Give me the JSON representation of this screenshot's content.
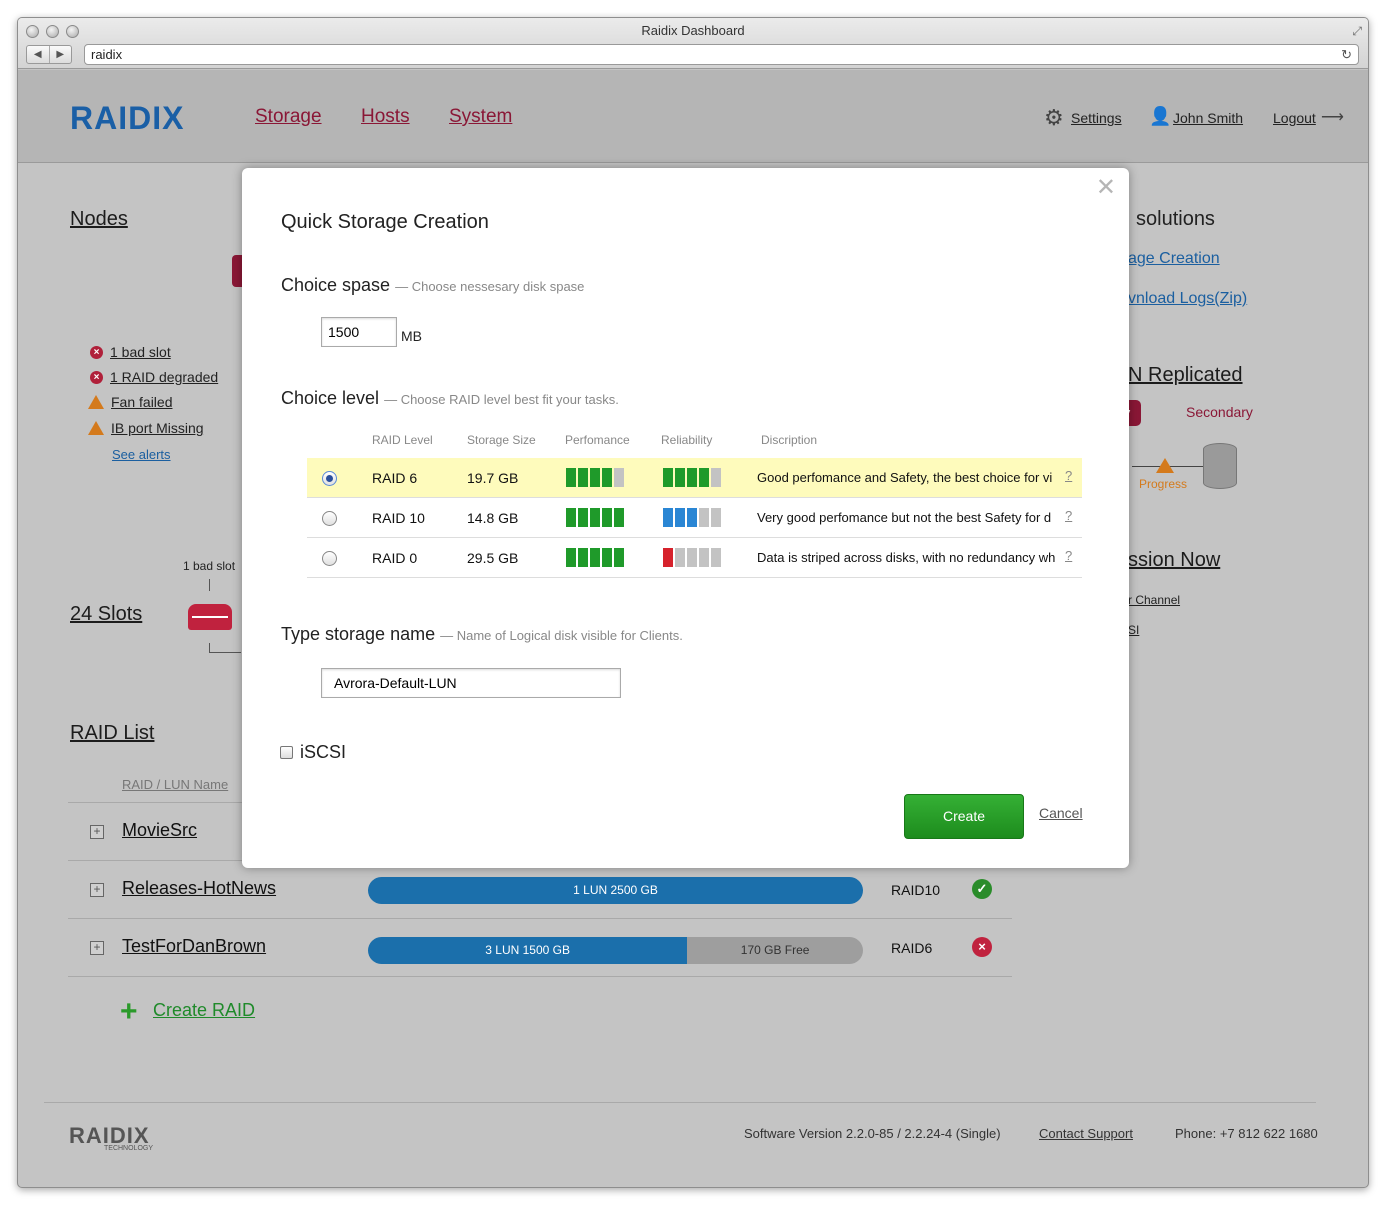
{
  "window": {
    "title": "Raidix Dashboard",
    "url": "raidix"
  },
  "header": {
    "logo": "RAIDIX",
    "nav": [
      "Storage",
      "Hosts",
      "System"
    ],
    "settings": "Settings",
    "user": "John Smith",
    "logout": "Logout"
  },
  "nodes": {
    "title": "Nodes",
    "alerts": [
      "1 bad slot",
      "1 RAID degraded",
      "Fan failed",
      "IB port Missing"
    ],
    "see_alerts": "See alerts"
  },
  "slots": {
    "title": "24 Slots",
    "bad_slot": "1 bad slot"
  },
  "raid_list": {
    "title": "RAID List",
    "column": "RAID / LUN Name",
    "rows": [
      {
        "name": "MovieSrc"
      },
      {
        "name": "Releases-HotNews",
        "bar": "1 LUN  2500 GB",
        "used_fraction": 1.0,
        "free": "",
        "level": "RAID10",
        "status": "ok"
      },
      {
        "name": "TestForDanBrown",
        "bar": "3 LUN  1500 GB",
        "used_fraction": 0.645,
        "free": "170 GB Free",
        "level": "RAID6",
        "status": "error"
      }
    ],
    "create": "Create RAID"
  },
  "right": {
    "solutions": "solutions",
    "link1": "age Creation",
    "link2": "vnload Logs(Zip)",
    "replicated": "N Replicated",
    "tag": "y",
    "secondary": "Secondary",
    "progress": "Progress",
    "session": "ssion Now",
    "channel": "r Channel",
    "si": "SI"
  },
  "footer": {
    "logo": "RAIDIX",
    "logo_sub": "TECHNOLOGY",
    "version": "Software Version 2.2.0-85 / 2.2.24-4 (Single)",
    "contact": "Contact Support",
    "phone": "Phone: +7 812 622 1680"
  },
  "modal": {
    "title": "Quick Storage Creation",
    "space": {
      "label": "Choice spase",
      "hint": "— Choose nessesary disk spase",
      "value": "1500",
      "unit": "MB"
    },
    "level": {
      "label": "Choice level",
      "hint": "— Choose RAID level best fit your tasks.",
      "headers": [
        "RAID Level",
        "Storage Size",
        "Perfomance",
        "Reliability",
        "Discription"
      ],
      "rows": [
        {
          "level": "RAID 6",
          "size": "19.7 GB",
          "perf": 4,
          "rel": 4,
          "rel_color": "green",
          "desc": "Good perfomance and Safety, the best choice for vi",
          "selected": true
        },
        {
          "level": "RAID 10",
          "size": "14.8 GB",
          "perf": 5,
          "rel": 3,
          "rel_color": "blue",
          "desc": "Very good perfomance but not the best Safety for d",
          "selected": false
        },
        {
          "level": "RAID 0",
          "size": "29.5 GB",
          "perf": 5,
          "rel": 1,
          "rel_color": "red",
          "desc": "Data is striped across disks, with no redundancy wh",
          "selected": false
        }
      ],
      "help": "?"
    },
    "name": {
      "label": "Type storage name",
      "hint": "— Name of Logical disk visible for Clients.",
      "value": "Avrora-Default-LUN"
    },
    "iscsi": "iSCSI",
    "create": "Create",
    "cancel": "Cancel"
  },
  "colors": {
    "brand": "#8a1736",
    "accent_blue": "#1b6fab",
    "ok": "#2a8c2a",
    "error": "#c0223e"
  }
}
